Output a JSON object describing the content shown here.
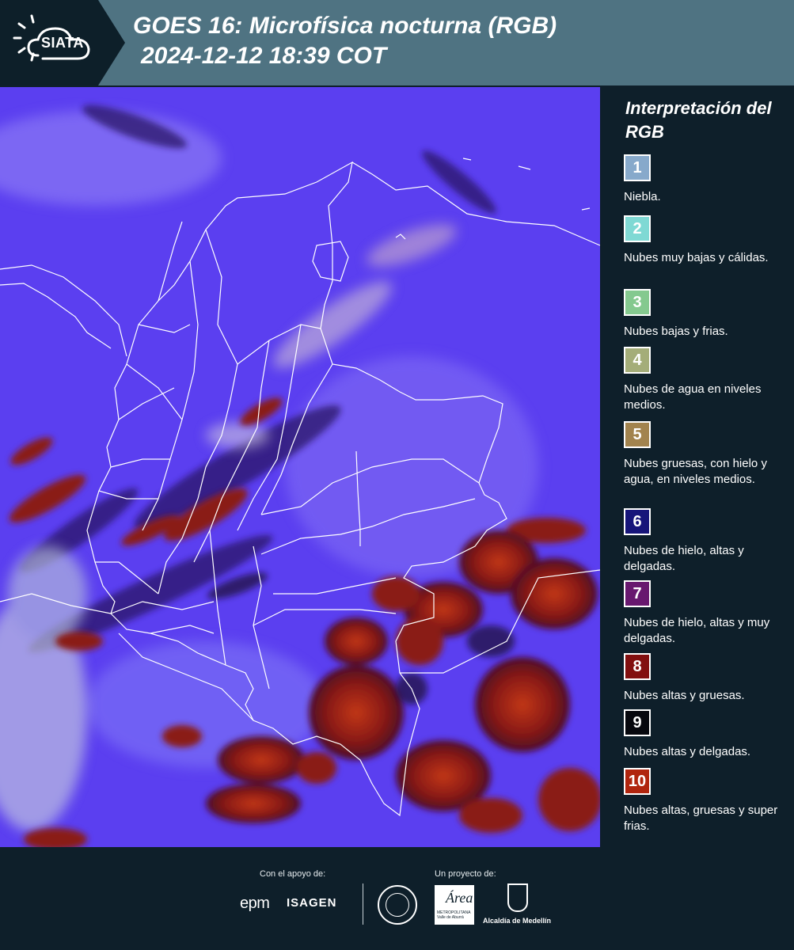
{
  "header": {
    "logo": "SIATA",
    "title_line1": "GOES 16: Microfísica nocturna (RGB)",
    "title_line2": "2024-12-12 18:39 COT"
  },
  "legend": {
    "title": "Interpretación del RGB",
    "items": [
      {
        "number": "1",
        "label": "Niebla.",
        "color": "#87a9cb"
      },
      {
        "number": "2",
        "label": "Nubes muy bajas y cálidas.",
        "color": "#7fd9d4"
      },
      {
        "number": "3",
        "label": "Nubes bajas y frias.",
        "color": "#84c98f"
      },
      {
        "number": "4",
        "label": "Nubes de agua en niveles medios.",
        "color": "#a4ad79"
      },
      {
        "number": "5",
        "label": "Nubes gruesas, con hielo y agua, en niveles medios.",
        "color": "#a2834e"
      },
      {
        "number": "6",
        "label": "Nubes de hielo, altas y delgadas.",
        "color": "#17157a"
      },
      {
        "number": "7",
        "label": "Nubes de hielo, altas y muy delgadas.",
        "color": "#68186f"
      },
      {
        "number": "8",
        "label": "Nubes altas y gruesas.",
        "color": "#820f0f"
      },
      {
        "number": "9",
        "label": "Nubes altas y delgadas.",
        "color": "#07080e"
      },
      {
        "number": "10",
        "label": "Nubes altas, gruesas y super frias.",
        "color": "#b0250e"
      }
    ]
  },
  "footer": {
    "support_label": "Con el apoyo de:",
    "project_label": "Un proyecto de:",
    "sponsor1": "epm",
    "sponsor2": "ISAGEN",
    "partner1": "Área",
    "partner1_sub": "METROPOLITANA Valle de Aburrá",
    "partner2": "Alcaldía de Medellín"
  },
  "colors": {
    "header_bg": "#4f7382",
    "panel_bg": "#0e1f2a",
    "map_base": "#5a3cf2",
    "thick_cloud": "#8a1a12",
    "border_lines": "#ffffff"
  }
}
